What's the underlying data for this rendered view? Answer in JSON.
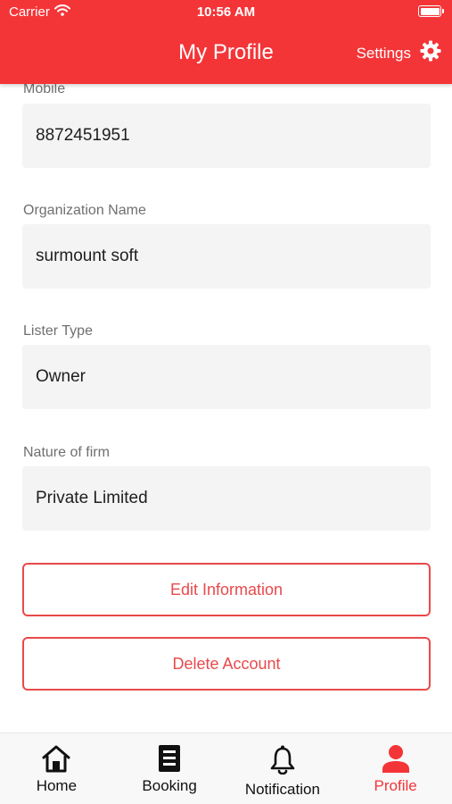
{
  "status_bar": {
    "carrier": "Carrier",
    "time": "10:56 AM"
  },
  "header": {
    "title": "My Profile",
    "settings_label": "Settings"
  },
  "fields": [
    {
      "label": "Mobile",
      "value": "8872451951"
    },
    {
      "label": "Organization Name",
      "value": "surmount soft"
    },
    {
      "label": "Lister Type",
      "value": "Owner"
    },
    {
      "label": "Nature of firm",
      "value": "Private Limited"
    }
  ],
  "actions": {
    "edit_label": "Edit Information",
    "delete_label": "Delete Account"
  },
  "tabs": [
    {
      "label": "Home",
      "icon": "home-icon"
    },
    {
      "label": "Booking",
      "icon": "booking-icon"
    },
    {
      "label": "Notification",
      "icon": "bell-icon"
    },
    {
      "label": "Profile",
      "icon": "person-icon",
      "active": true
    }
  ],
  "colors": {
    "accent": "#f43538",
    "field_bg": "#f4f4f4",
    "button_border": "#e9494b"
  }
}
